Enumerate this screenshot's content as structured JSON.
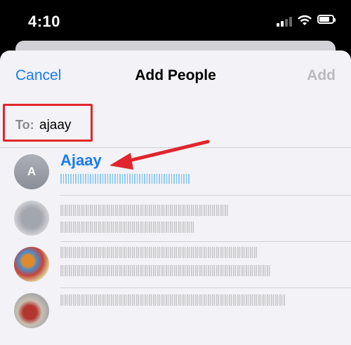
{
  "status": {
    "time": "4:10"
  },
  "nav": {
    "cancel": "Cancel",
    "title": "Add People",
    "add": "Add"
  },
  "to_field": {
    "label": "To:",
    "value": "ajaay"
  },
  "contacts": [
    {
      "initial": "A",
      "name": "Ajaay"
    }
  ],
  "colors": {
    "accent": "#1a7af0",
    "highlight": "#e0252c",
    "background": "#f2f2f7"
  }
}
